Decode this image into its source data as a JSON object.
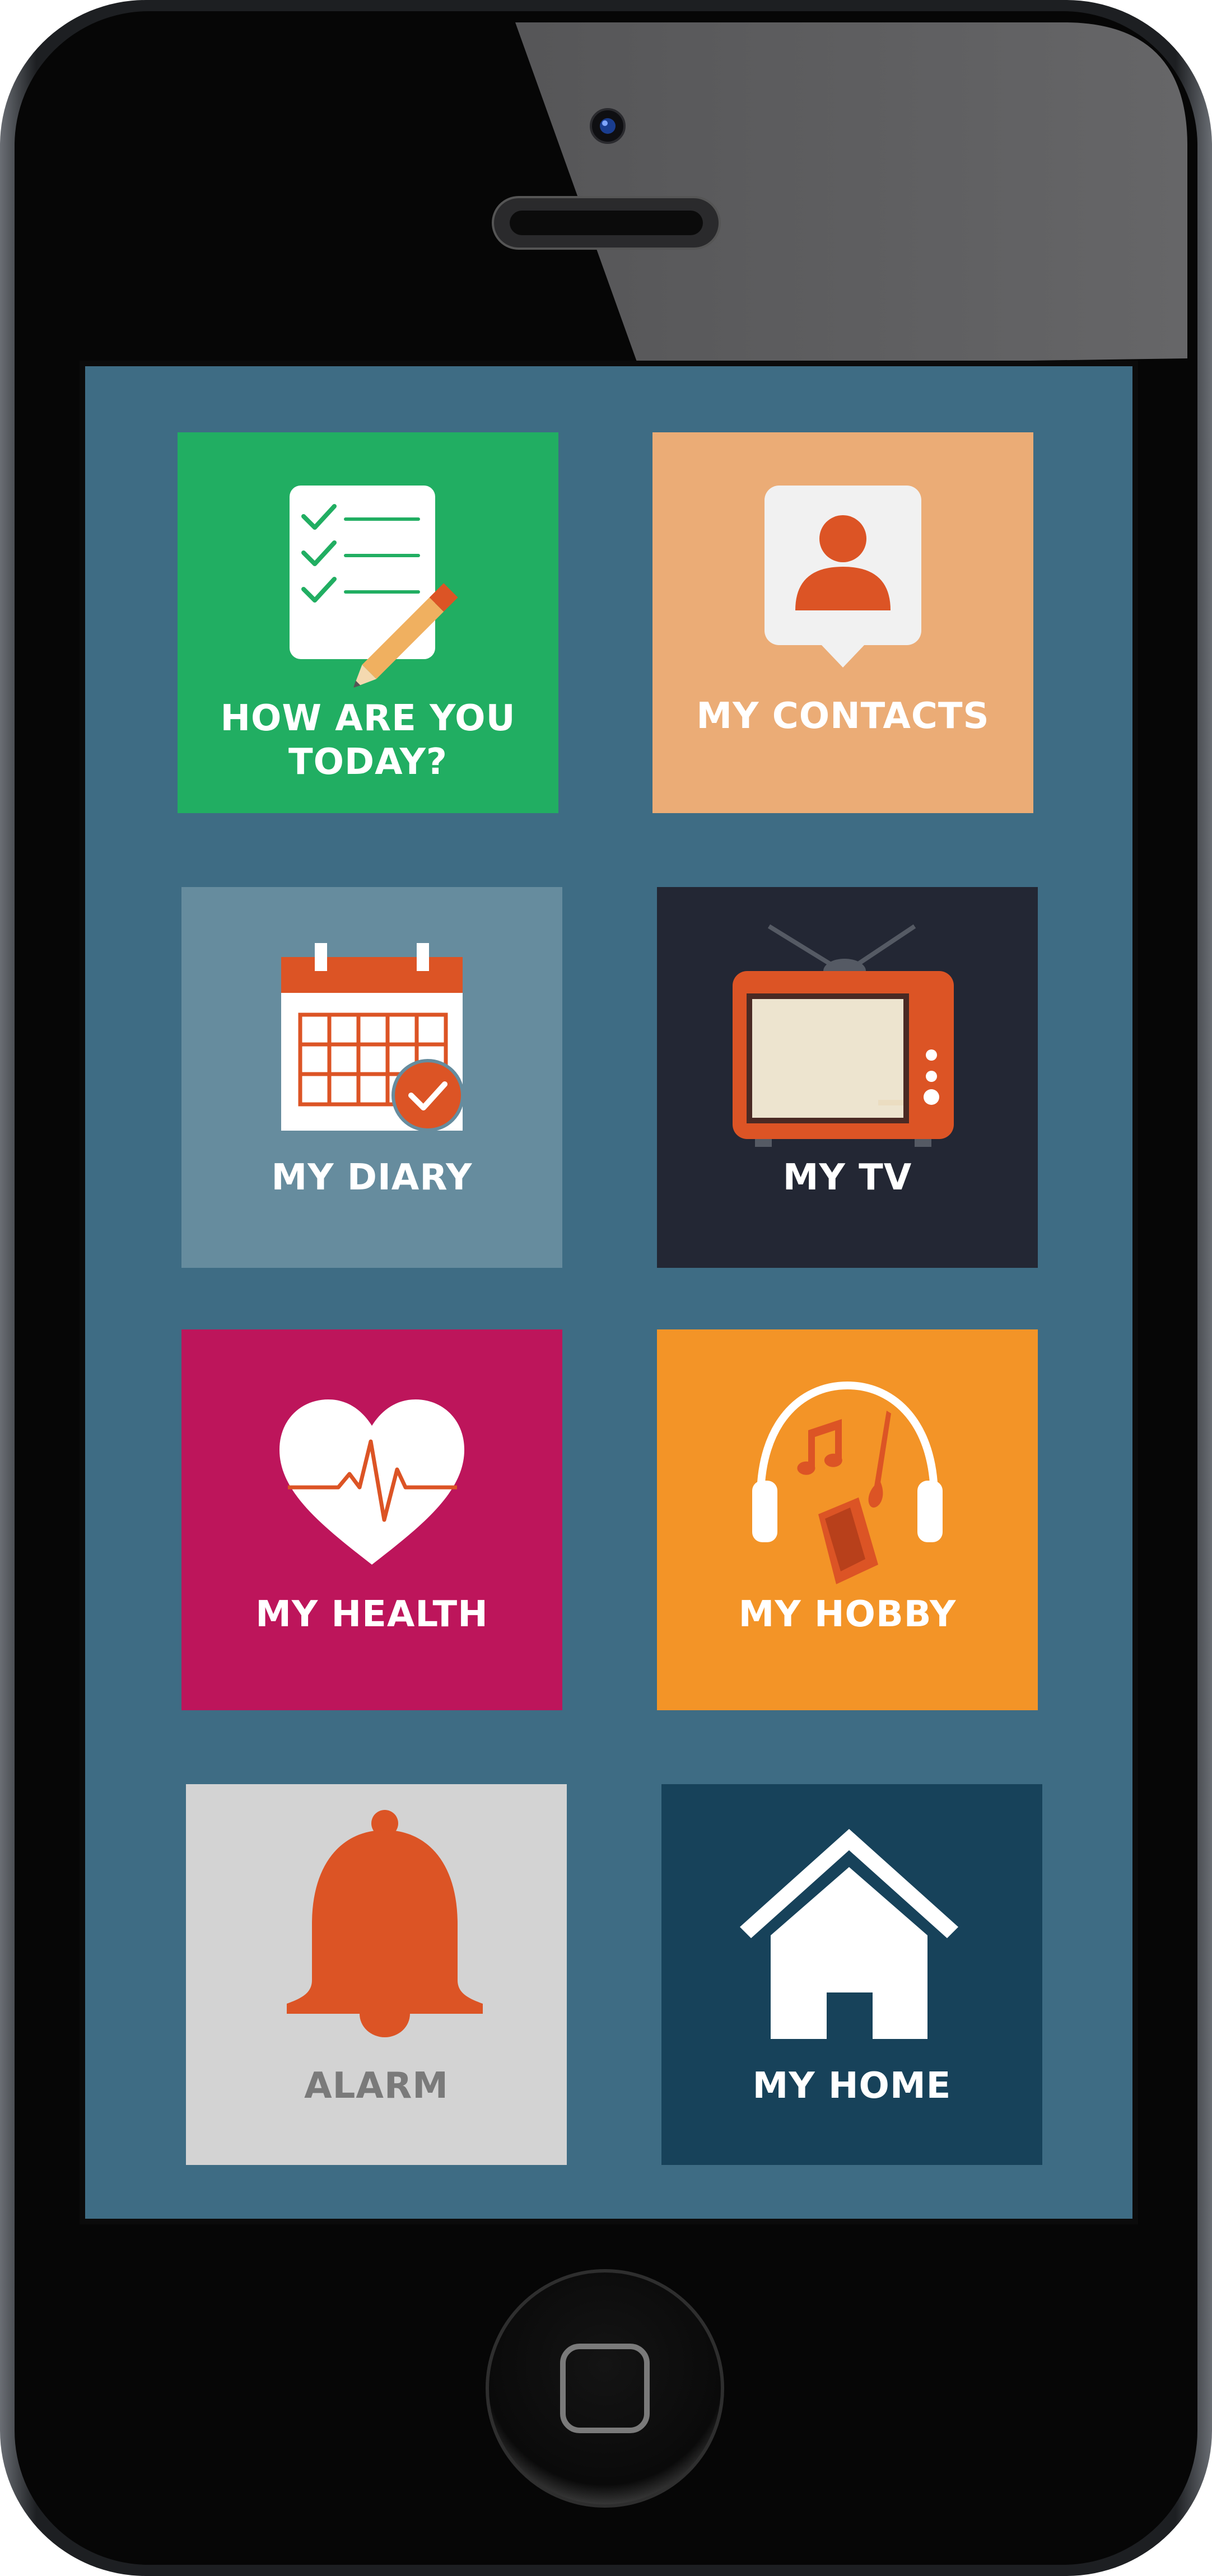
{
  "tiles": [
    {
      "id": "how-are-you",
      "label": "HOW ARE YOU TODAY?",
      "line1": "HOW ARE YOU",
      "line2": "TODAY?",
      "icon": "checklist-icon",
      "bg": "#21ae62",
      "fg": "#ffffff"
    },
    {
      "id": "contacts",
      "label": "MY CONTACTS",
      "icon": "contact-icon",
      "bg": "#ebac76",
      "fg": "#ffffff"
    },
    {
      "id": "diary",
      "label": "MY DIARY",
      "icon": "calendar-icon",
      "bg": "#668c9e",
      "fg": "#ffffff"
    },
    {
      "id": "tv",
      "label": "MY TV",
      "icon": "tv-icon",
      "bg": "#232734",
      "fg": "#ffffff"
    },
    {
      "id": "health",
      "label": "MY HEALTH",
      "icon": "heart-icon",
      "bg": "#bd155b",
      "fg": "#ffffff"
    },
    {
      "id": "hobby",
      "label": "MY HOBBY",
      "icon": "headphones-icon",
      "bg": "#f39427",
      "fg": "#ffffff"
    },
    {
      "id": "alarm",
      "label": "ALARM",
      "icon": "bell-icon",
      "bg": "#d3d3d3",
      "fg": "#7a7a7a"
    },
    {
      "id": "home",
      "label": "MY HOME",
      "icon": "house-icon",
      "bg": "#17425a",
      "fg": "#ffffff"
    }
  ],
  "colors": {
    "screen_bg": "#3e6c84",
    "accent": "#dc5425"
  }
}
